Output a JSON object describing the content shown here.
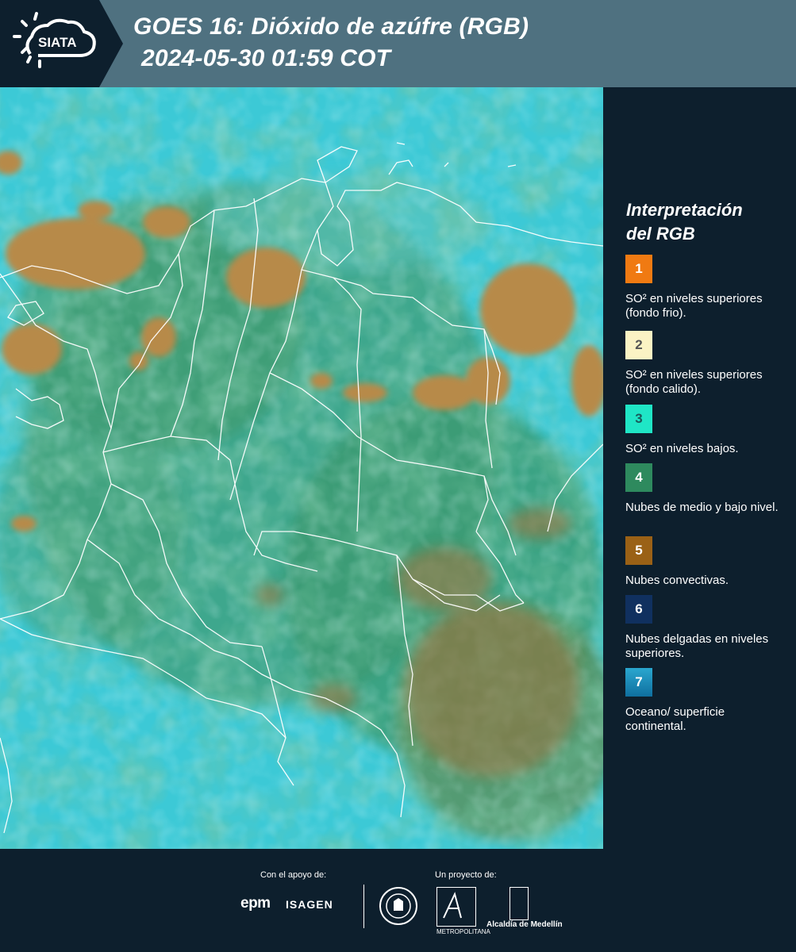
{
  "header": {
    "logo_text": "SIATA",
    "title_line1": "GOES 16: Dióxido de azúfre (RGB)",
    "title_line2": "2024-05-30 01:59 COT"
  },
  "legend": {
    "title_line1": "Interpretación",
    "title_line2": "del RGB",
    "items": [
      {
        "number": "1",
        "color": "#f07a12",
        "label": "SO² en niveles superiores (fondo frio)."
      },
      {
        "number": "2",
        "color": "#fbf3c4",
        "label": "SO² en niveles superiores (fondo calido)."
      },
      {
        "number": "3",
        "color": "#1fe6c6",
        "label": "SO² en niveles bajos."
      },
      {
        "number": "4",
        "color": "#2e8a5e",
        "label": "Nubes de medio y bajo nivel."
      },
      {
        "number": "5",
        "color": "#9a6116",
        "label": "Nubes convectivas."
      },
      {
        "number": "6",
        "color": "#10305f",
        "label": "Nubes delgadas en niveles superiores."
      },
      {
        "number": "7",
        "color": "#1a8cc0",
        "label": "Oceano/ superficie continental."
      }
    ]
  },
  "footer": {
    "support_label": "Con el apoyo de:",
    "project_label": "Un proyecto de:",
    "epm": "epm",
    "isagen": "ISAGEN",
    "area_text": "METROPOLITANA",
    "alcaldia": "Alcaldía de Medellín"
  }
}
